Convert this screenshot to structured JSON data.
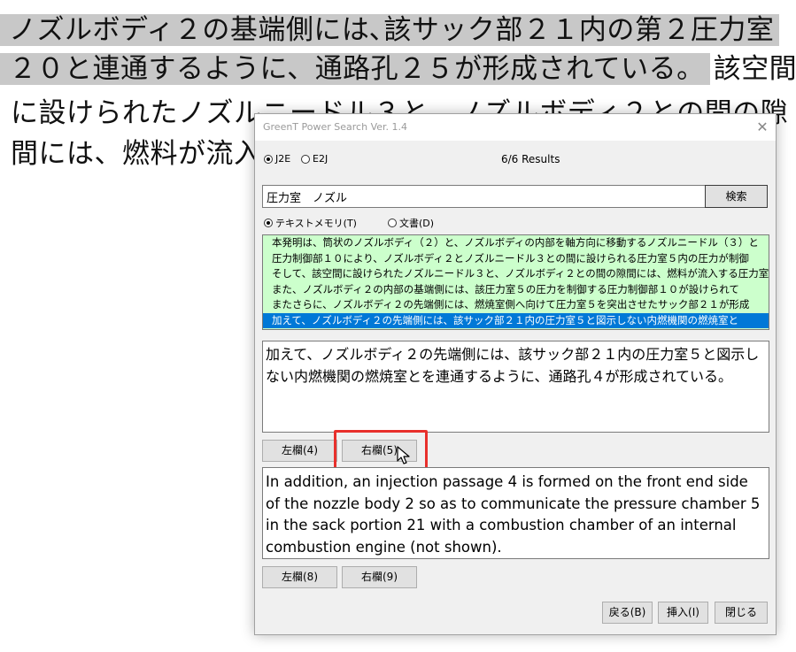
{
  "document": {
    "line1": "ノズルボディ２の基端側には､該サック部２１内の第２圧力室",
    "line2_selected": "２０と連通するように、通路孔２５が形成されている。",
    "line2_rest": "該空間",
    "line3": "に設けられたノズルニードル３と、ノズルボディ２との間の隙",
    "line4": "間には、燃料が流入"
  },
  "dialog": {
    "title": "GreenT Power Search  Ver. 1.4",
    "close_glyph": "✕",
    "mode_j2e": "J2E",
    "mode_e2j": "E2J",
    "results_count": "6/6 Results",
    "search_value": "圧力室　ノズル",
    "search_button": "検索",
    "source_memory": "テキストメモリ(T)",
    "source_document": "文書(D)",
    "results": [
      "本発明は、筒状のノズルボディ（２）と、ノズルボディの内部を軸方向に移動するノズルニードル（３）と",
      "圧力制御部１０により、ノズルボディ２とノズルニードル３との間に設けられる圧力室５内の圧力が制御",
      "そして、該空間に設けられたノズルニードル３と、ノズルボディ２との間の隙間には、燃料が流入する圧力室",
      "また、ノズルボディ２の内部の基端側には、該圧力室５の圧力を制御する圧力制御部１０が設けられて",
      "またさらに、ノズルボディ２の先端側には、燃焼室側へ向けて圧力室５を突出させたサック部２１が形成",
      "加えて、ノズルボディ２の先端側には、該サック部２１内の圧力室５と図示しない内燃機関の燃焼室と"
    ],
    "japanese_text": "加えて、ノズルボディ２の先端側には、該サック部２１内の圧力室５と図示しない内燃機関の燃焼室とを連通するように、通路孔４が形成されている。",
    "left_col_button_1": "左欄(4)",
    "right_col_button_1": "右欄(5)",
    "english_text": "In addition, an injection passage 4 is formed on the front end side of the nozzle body 2 so as to communicate the pressure chamber 5 in the sack portion 21 with a combustion chamber of an internal combustion engine (not shown).",
    "left_col_button_2": "左欄(8)",
    "right_col_button_2": "右欄(9)",
    "back_button": "戻る(B)",
    "insert_button": "挿入(I)",
    "close_button": "閉じる"
  },
  "colors": {
    "list_background": "#ccffcc",
    "selection": "#0078d7",
    "highlight": "#e8302c"
  }
}
